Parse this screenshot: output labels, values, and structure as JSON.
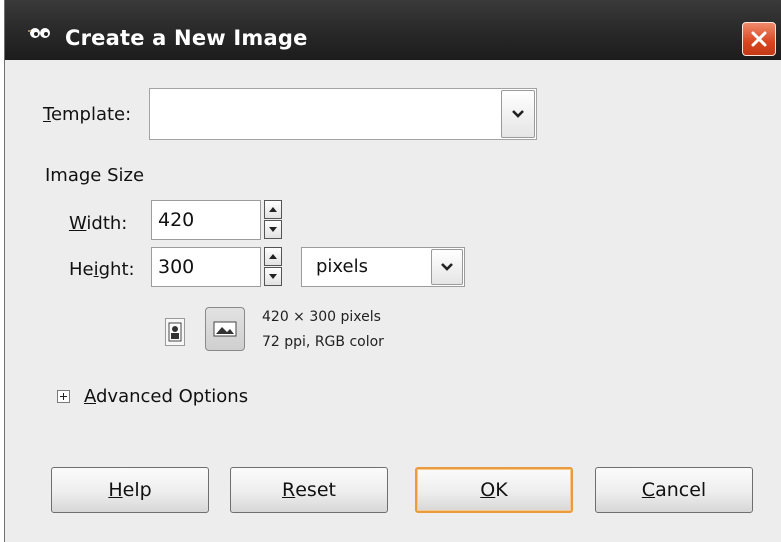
{
  "window": {
    "title": "Create a New Image",
    "close_icon": "close-x-icon",
    "app_icon": "gimp-wilber-icon"
  },
  "template": {
    "label_mnemonic": "T",
    "label_rest": "emplate:",
    "value": ""
  },
  "image_size": {
    "section_label": "Image Size",
    "width_label_mnemonic": "W",
    "width_label_rest": "idth:",
    "width_value": "420",
    "height_label_pre": "He",
    "height_label_mnemonic": "i",
    "height_label_rest": "ght:",
    "height_value": "300",
    "unit_value": "pixels",
    "info_line1": "420 × 300 pixels",
    "info_line2": "72 ppi, RGB color"
  },
  "advanced": {
    "label_mnemonic": "A",
    "label_rest": "dvanced Options"
  },
  "buttons": {
    "help_mnemonic": "H",
    "help_rest": "elp",
    "reset_mnemonic": "R",
    "reset_rest": "eset",
    "ok_mnemonic": "O",
    "ok_rest": "K",
    "cancel_mnemonic": "C",
    "cancel_rest": "ancel"
  },
  "colors": {
    "titlebar": "#2b2b2b",
    "close_button": "#d9451f",
    "dialog_bg": "#ededed",
    "default_button_border": "#e89c3f"
  }
}
